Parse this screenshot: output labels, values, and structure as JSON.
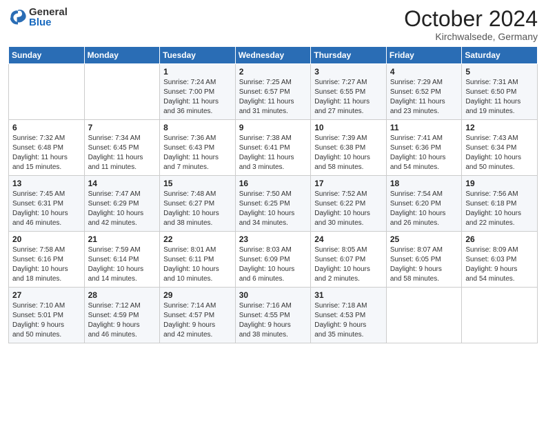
{
  "logo": {
    "general": "General",
    "blue": "Blue"
  },
  "header": {
    "month": "October 2024",
    "location": "Kirchwalsede, Germany"
  },
  "days_of_week": [
    "Sunday",
    "Monday",
    "Tuesday",
    "Wednesday",
    "Thursday",
    "Friday",
    "Saturday"
  ],
  "weeks": [
    [
      {
        "day": "",
        "lines": []
      },
      {
        "day": "",
        "lines": []
      },
      {
        "day": "1",
        "lines": [
          "Sunrise: 7:24 AM",
          "Sunset: 7:00 PM",
          "Daylight: 11 hours",
          "and 36 minutes."
        ]
      },
      {
        "day": "2",
        "lines": [
          "Sunrise: 7:25 AM",
          "Sunset: 6:57 PM",
          "Daylight: 11 hours",
          "and 31 minutes."
        ]
      },
      {
        "day": "3",
        "lines": [
          "Sunrise: 7:27 AM",
          "Sunset: 6:55 PM",
          "Daylight: 11 hours",
          "and 27 minutes."
        ]
      },
      {
        "day": "4",
        "lines": [
          "Sunrise: 7:29 AM",
          "Sunset: 6:52 PM",
          "Daylight: 11 hours",
          "and 23 minutes."
        ]
      },
      {
        "day": "5",
        "lines": [
          "Sunrise: 7:31 AM",
          "Sunset: 6:50 PM",
          "Daylight: 11 hours",
          "and 19 minutes."
        ]
      }
    ],
    [
      {
        "day": "6",
        "lines": [
          "Sunrise: 7:32 AM",
          "Sunset: 6:48 PM",
          "Daylight: 11 hours",
          "and 15 minutes."
        ]
      },
      {
        "day": "7",
        "lines": [
          "Sunrise: 7:34 AM",
          "Sunset: 6:45 PM",
          "Daylight: 11 hours",
          "and 11 minutes."
        ]
      },
      {
        "day": "8",
        "lines": [
          "Sunrise: 7:36 AM",
          "Sunset: 6:43 PM",
          "Daylight: 11 hours",
          "and 7 minutes."
        ]
      },
      {
        "day": "9",
        "lines": [
          "Sunrise: 7:38 AM",
          "Sunset: 6:41 PM",
          "Daylight: 11 hours",
          "and 3 minutes."
        ]
      },
      {
        "day": "10",
        "lines": [
          "Sunrise: 7:39 AM",
          "Sunset: 6:38 PM",
          "Daylight: 10 hours",
          "and 58 minutes."
        ]
      },
      {
        "day": "11",
        "lines": [
          "Sunrise: 7:41 AM",
          "Sunset: 6:36 PM",
          "Daylight: 10 hours",
          "and 54 minutes."
        ]
      },
      {
        "day": "12",
        "lines": [
          "Sunrise: 7:43 AM",
          "Sunset: 6:34 PM",
          "Daylight: 10 hours",
          "and 50 minutes."
        ]
      }
    ],
    [
      {
        "day": "13",
        "lines": [
          "Sunrise: 7:45 AM",
          "Sunset: 6:31 PM",
          "Daylight: 10 hours",
          "and 46 minutes."
        ]
      },
      {
        "day": "14",
        "lines": [
          "Sunrise: 7:47 AM",
          "Sunset: 6:29 PM",
          "Daylight: 10 hours",
          "and 42 minutes."
        ]
      },
      {
        "day": "15",
        "lines": [
          "Sunrise: 7:48 AM",
          "Sunset: 6:27 PM",
          "Daylight: 10 hours",
          "and 38 minutes."
        ]
      },
      {
        "day": "16",
        "lines": [
          "Sunrise: 7:50 AM",
          "Sunset: 6:25 PM",
          "Daylight: 10 hours",
          "and 34 minutes."
        ]
      },
      {
        "day": "17",
        "lines": [
          "Sunrise: 7:52 AM",
          "Sunset: 6:22 PM",
          "Daylight: 10 hours",
          "and 30 minutes."
        ]
      },
      {
        "day": "18",
        "lines": [
          "Sunrise: 7:54 AM",
          "Sunset: 6:20 PM",
          "Daylight: 10 hours",
          "and 26 minutes."
        ]
      },
      {
        "day": "19",
        "lines": [
          "Sunrise: 7:56 AM",
          "Sunset: 6:18 PM",
          "Daylight: 10 hours",
          "and 22 minutes."
        ]
      }
    ],
    [
      {
        "day": "20",
        "lines": [
          "Sunrise: 7:58 AM",
          "Sunset: 6:16 PM",
          "Daylight: 10 hours",
          "and 18 minutes."
        ]
      },
      {
        "day": "21",
        "lines": [
          "Sunrise: 7:59 AM",
          "Sunset: 6:14 PM",
          "Daylight: 10 hours",
          "and 14 minutes."
        ]
      },
      {
        "day": "22",
        "lines": [
          "Sunrise: 8:01 AM",
          "Sunset: 6:11 PM",
          "Daylight: 10 hours",
          "and 10 minutes."
        ]
      },
      {
        "day": "23",
        "lines": [
          "Sunrise: 8:03 AM",
          "Sunset: 6:09 PM",
          "Daylight: 10 hours",
          "and 6 minutes."
        ]
      },
      {
        "day": "24",
        "lines": [
          "Sunrise: 8:05 AM",
          "Sunset: 6:07 PM",
          "Daylight: 10 hours",
          "and 2 minutes."
        ]
      },
      {
        "day": "25",
        "lines": [
          "Sunrise: 8:07 AM",
          "Sunset: 6:05 PM",
          "Daylight: 9 hours",
          "and 58 minutes."
        ]
      },
      {
        "day": "26",
        "lines": [
          "Sunrise: 8:09 AM",
          "Sunset: 6:03 PM",
          "Daylight: 9 hours",
          "and 54 minutes."
        ]
      }
    ],
    [
      {
        "day": "27",
        "lines": [
          "Sunrise: 7:10 AM",
          "Sunset: 5:01 PM",
          "Daylight: 9 hours",
          "and 50 minutes."
        ]
      },
      {
        "day": "28",
        "lines": [
          "Sunrise: 7:12 AM",
          "Sunset: 4:59 PM",
          "Daylight: 9 hours",
          "and 46 minutes."
        ]
      },
      {
        "day": "29",
        "lines": [
          "Sunrise: 7:14 AM",
          "Sunset: 4:57 PM",
          "Daylight: 9 hours",
          "and 42 minutes."
        ]
      },
      {
        "day": "30",
        "lines": [
          "Sunrise: 7:16 AM",
          "Sunset: 4:55 PM",
          "Daylight: 9 hours",
          "and 38 minutes."
        ]
      },
      {
        "day": "31",
        "lines": [
          "Sunrise: 7:18 AM",
          "Sunset: 4:53 PM",
          "Daylight: 9 hours",
          "and 35 minutes."
        ]
      },
      {
        "day": "",
        "lines": []
      },
      {
        "day": "",
        "lines": []
      }
    ]
  ]
}
